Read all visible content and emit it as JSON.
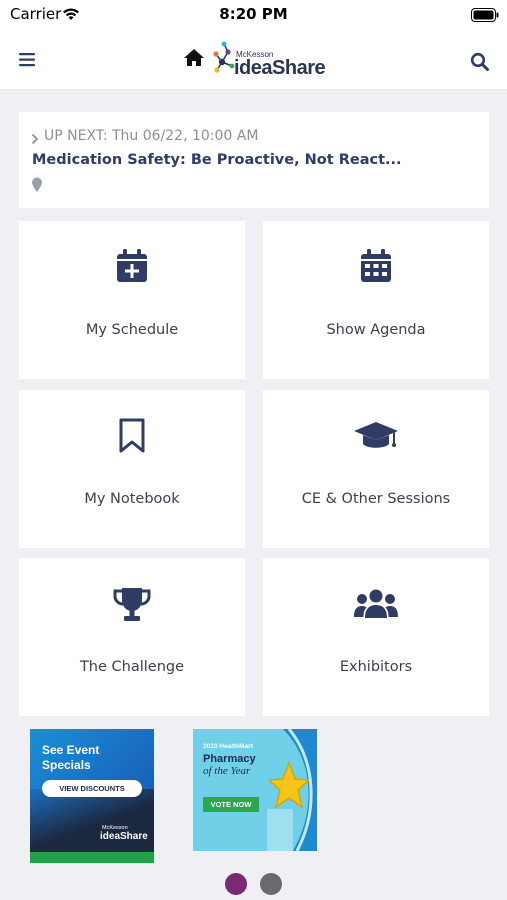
{
  "status_bar": {
    "carrier": "Carrier",
    "time": "8:20 PM"
  },
  "header": {
    "brand_small": "McKesson",
    "brand_big": "ideaShare",
    "icons": [
      "menu-icon",
      "home-icon",
      "search-icon"
    ]
  },
  "up_next": {
    "label": "UP NEXT: Thu 06/22, 10:00 AM",
    "title": "Medication Safety: Be Proactive, Not React..."
  },
  "tiles": [
    {
      "label": "My Schedule",
      "icon": "calendar-plus-icon"
    },
    {
      "label": "Show Agenda",
      "icon": "calendar-grid-icon"
    },
    {
      "label": "My Notebook",
      "icon": "bookmark-icon"
    },
    {
      "label": "CE & Other Sessions",
      "icon": "graduation-cap-icon"
    },
    {
      "label": "The Challenge",
      "icon": "trophy-icon"
    },
    {
      "label": "Exhibitors",
      "icon": "group-icon"
    }
  ],
  "banners": [
    {
      "heading": "See Event Specials",
      "button": "VIEW DISCOUNTS",
      "logo_small": "McKesson",
      "logo_big": "ideaShare"
    },
    {
      "year_line": "2023 HealthMart",
      "title": "Pharmacy",
      "subtitle": "of the Year",
      "button": "VOTE NOW"
    }
  ],
  "pager": {
    "count": 2,
    "active_index": 0
  },
  "colors": {
    "accent_navy": "#2f3d66",
    "background": "#eef0f4",
    "pager_active": "#7a2a73",
    "pager_inactive": "#6a6a6e"
  }
}
